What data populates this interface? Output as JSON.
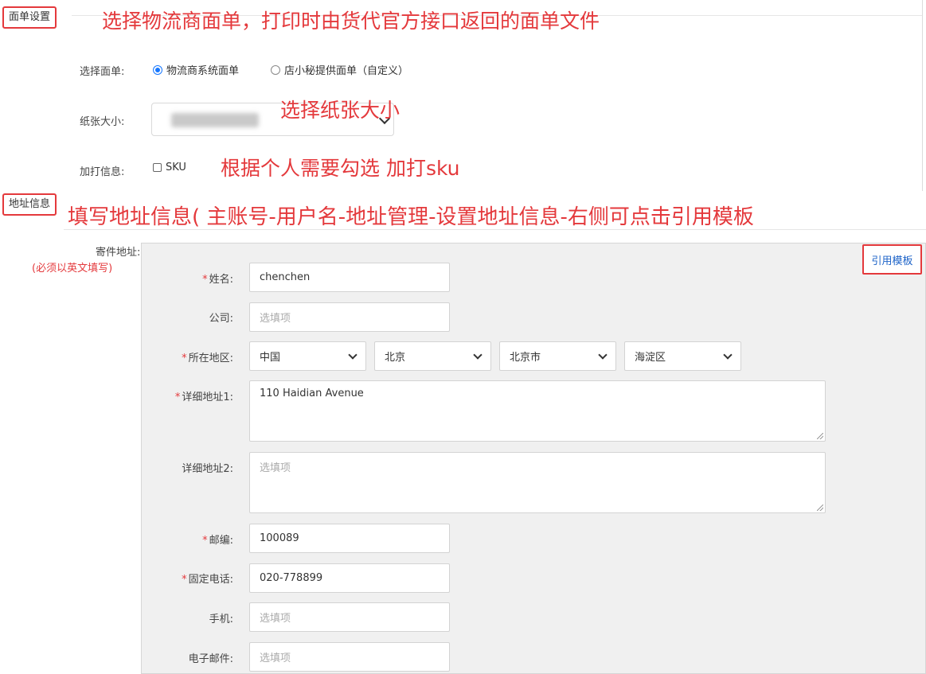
{
  "sections": {
    "form_settings_tag": "面单设置",
    "address_info_tag": "地址信息"
  },
  "annotations": {
    "form_settings": "选择物流商面单，打印时由货代官方接口返回的面单文件",
    "paper_size": "选择纸张大小",
    "extra_info": "根据个人需要勾选 加打sku",
    "address_info": "填写地址信息( 主账号-用户名-地址管理-设置地址信息-右侧可点击引用模板"
  },
  "form_settings": {
    "select_form_label": "选择面单:",
    "option_logistics": "物流商系统面单",
    "option_custom": "店小秘提供面单（自定义）",
    "selected_option": "物流商系统面单",
    "paper_size_label": "纸张大小:",
    "extra_info_label": "加打信息:",
    "sku_label": "SKU"
  },
  "address": {
    "sender_label": "寄件地址:",
    "sender_note": "(必须以英文填写)",
    "cite_template_button": "引用模板",
    "name_label": "姓名:",
    "name_value": "chenchen",
    "company_label": "公司:",
    "company_placeholder": "选填项",
    "region_label": "所在地区:",
    "country": "中国",
    "province": "北京",
    "city": "北京市",
    "district": "海淀区",
    "address1_label": "详细地址1:",
    "address1_value": "110 Haidian Avenue",
    "address2_label": "详细地址2:",
    "address2_placeholder": "选填项",
    "postcode_label": "邮编:",
    "postcode_value": "100089",
    "phone_label": "固定电话:",
    "phone_value": "020-778899",
    "mobile_label": "手机:",
    "mobile_placeholder": "选填项",
    "email_label": "电子邮件:",
    "email_placeholder": "选填项",
    "required_mark": "*"
  },
  "colors": {
    "annotation_red": "#e4393c",
    "radio_blue": "#1677ff",
    "link_blue": "#1d63c8",
    "panel_gray": "#f0f0f0"
  }
}
